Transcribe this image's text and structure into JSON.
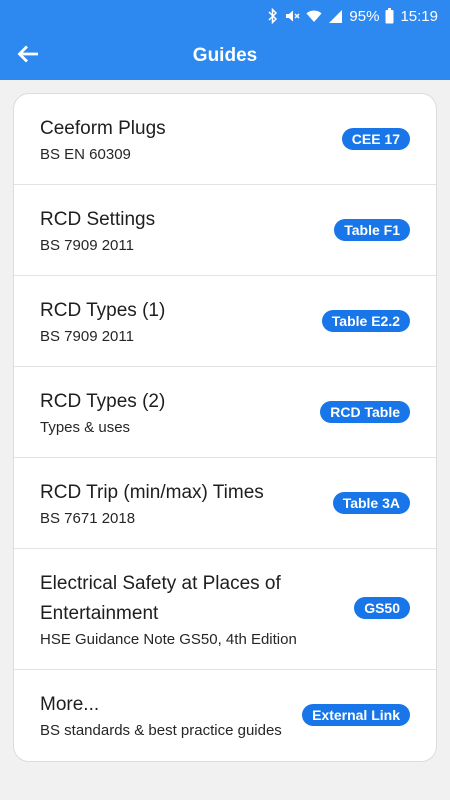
{
  "status_bar": {
    "battery": "95%",
    "time": "15:19",
    "icons": [
      "bluetooth-icon",
      "mute-icon",
      "wifi-icon",
      "signal-icon",
      "battery-icon"
    ]
  },
  "app_bar": {
    "title": "Guides",
    "back_icon": "arrow-left-icon"
  },
  "colors": {
    "primary": "#2d89ef",
    "badge": "#1976e8",
    "background": "#f1f1f1"
  },
  "guides": [
    {
      "title": "Ceeform Plugs",
      "subtitle": "BS EN 60309",
      "badge": "CEE 17"
    },
    {
      "title": "RCD Settings",
      "subtitle": "BS 7909 2011",
      "badge": "Table F1"
    },
    {
      "title": "RCD Types (1)",
      "subtitle": "BS 7909 2011",
      "badge": "Table E2.2"
    },
    {
      "title": "RCD Types (2)",
      "subtitle": "Types & uses",
      "badge": "RCD Table"
    },
    {
      "title": "RCD Trip (min/max) Times",
      "subtitle": "BS 7671 2018",
      "badge": "Table 3A"
    },
    {
      "title": "Electrical Safety at Places of Entertainment",
      "subtitle": "HSE Guidance Note GS50, 4th Edition",
      "badge": "GS50"
    },
    {
      "title": "More...",
      "subtitle": "BS standards & best practice guides",
      "badge": "External Link"
    }
  ]
}
